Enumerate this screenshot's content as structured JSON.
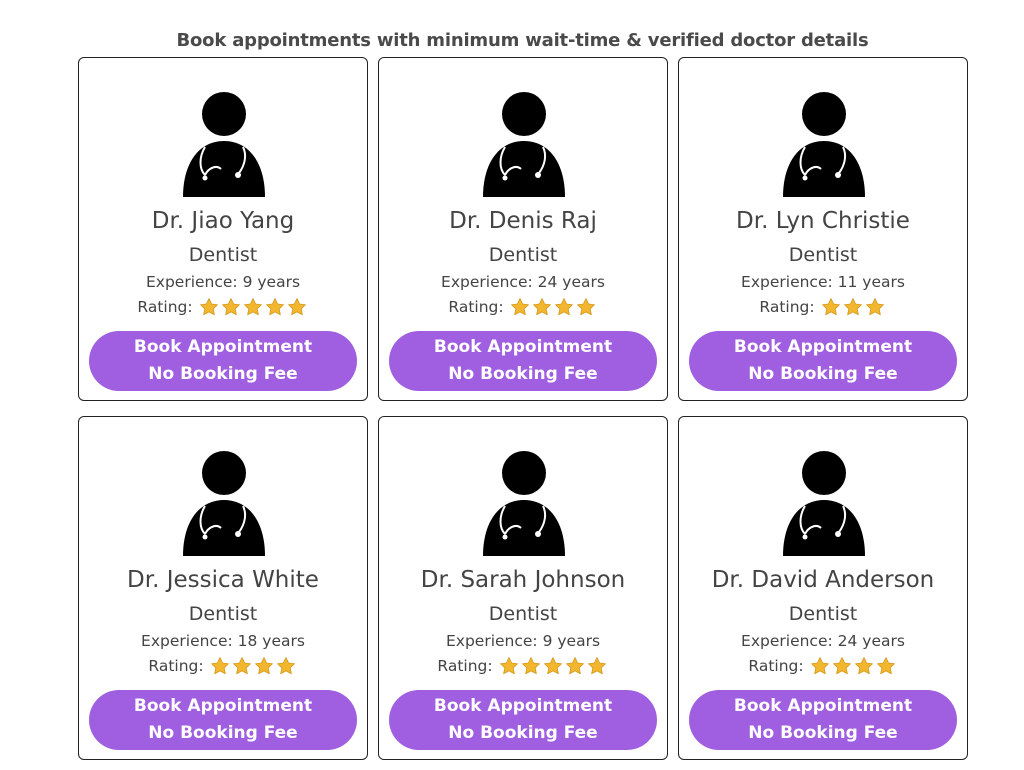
{
  "header": {
    "title": "Book appointments with minimum wait-time & verified doctor details"
  },
  "colors": {
    "button": "#9f5fe0",
    "star": "#f2b62f"
  },
  "doctors": [
    {
      "name": "Dr. Jiao Yang",
      "specialty": "Dentist",
      "experience": "Experience: 9 years",
      "rating_label": "Rating:",
      "stars": 5,
      "button_line1": "Book Appointment",
      "button_line2": "No Booking Fee"
    },
    {
      "name": "Dr. Denis Raj",
      "specialty": "Dentist",
      "experience": "Experience: 24 years",
      "rating_label": "Rating:",
      "stars": 4,
      "button_line1": "Book Appointment",
      "button_line2": "No Booking Fee"
    },
    {
      "name": "Dr. Lyn Christie",
      "specialty": "Dentist",
      "experience": "Experience: 11 years",
      "rating_label": "Rating:",
      "stars": 3,
      "button_line1": "Book Appointment",
      "button_line2": "No Booking Fee"
    },
    {
      "name": "Dr. Jessica White",
      "specialty": "Dentist",
      "experience": "Experience: 18 years",
      "rating_label": "Rating:",
      "stars": 4,
      "button_line1": "Book Appointment",
      "button_line2": "No Booking Fee"
    },
    {
      "name": "Dr. Sarah Johnson",
      "specialty": "Dentist",
      "experience": "Experience: 9 years",
      "rating_label": "Rating:",
      "stars": 5,
      "button_line1": "Book Appointment",
      "button_line2": "No Booking Fee"
    },
    {
      "name": "Dr. David Anderson",
      "specialty": "Dentist",
      "experience": "Experience: 24 years",
      "rating_label": "Rating:",
      "stars": 4,
      "button_line1": "Book Appointment",
      "button_line2": "No Booking Fee"
    }
  ]
}
